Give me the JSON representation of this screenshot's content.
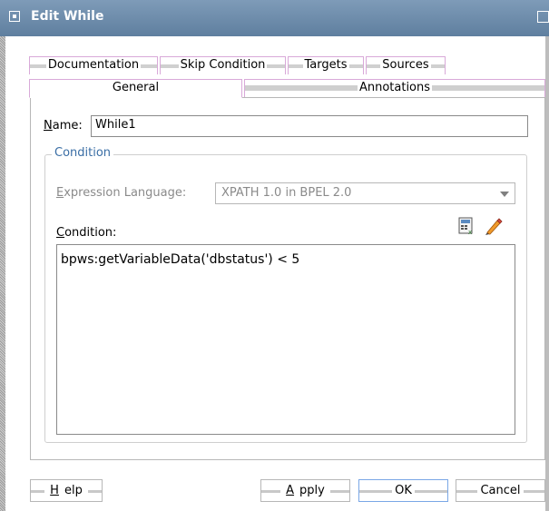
{
  "window": {
    "title": "Edit While"
  },
  "tabs": {
    "row1": [
      "Documentation",
      "Skip Condition",
      "Targets",
      "Sources"
    ],
    "row2": [
      "General",
      "Annotations"
    ],
    "active": "General"
  },
  "general": {
    "name_label_mnemonic": "N",
    "name_label_rest": "ame:",
    "name_value": "While1",
    "condition_group_title": "Condition",
    "expression_language_mnemonic": "E",
    "expression_language_rest": "xpression Language:",
    "expression_language_value": "XPATH 1.0 in BPEL 2.0",
    "condition_label_mnemonic": "C",
    "condition_label_rest": "ondition:",
    "condition_value": "bpws:getVariableData('dbstatus') < 5"
  },
  "icons": {
    "xpath_builder": "xpath-expression-builder-icon",
    "edit": "pencil-icon"
  },
  "buttons": {
    "help_mnemonic": "H",
    "help_rest": "elp",
    "apply_mnemonic": "A",
    "apply_rest": "pply",
    "ok": "OK",
    "cancel": "Cancel"
  },
  "colors": {
    "titlebar": "#6f8fae",
    "group_title": "#3a6ea5",
    "focus_border": "#7aa7e6",
    "tab_border": "#d9a9d9"
  }
}
